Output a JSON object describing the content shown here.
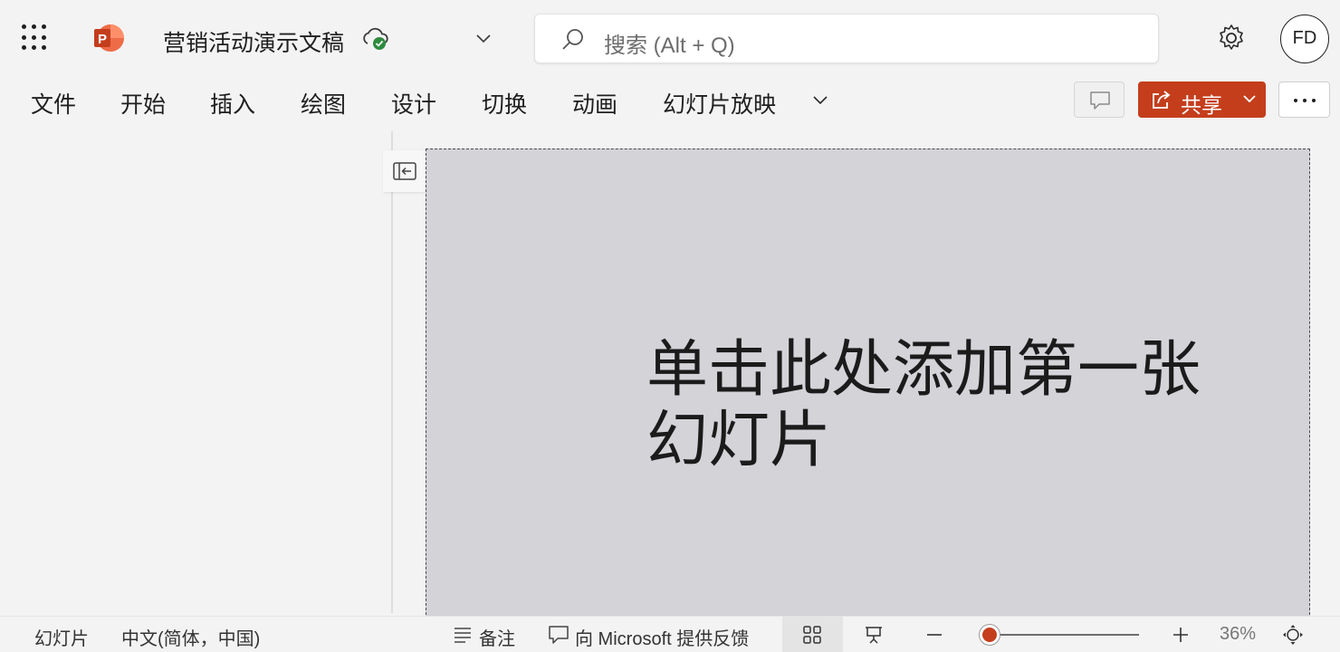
{
  "app": {
    "document_title": "营销活动演示文稿",
    "icons": {
      "app_launcher": "waffle-icon",
      "app_logo": "powerpoint-logo",
      "save_status": "cloud-saved-icon",
      "settings": "gear-icon"
    },
    "search": {
      "placeholder": "搜索 (Alt + Q)"
    },
    "user": {
      "initials": "FD"
    }
  },
  "ribbon": {
    "tabs": [
      {
        "label": "文件"
      },
      {
        "label": "开始"
      },
      {
        "label": "插入"
      },
      {
        "label": "绘图"
      },
      {
        "label": "设计"
      },
      {
        "label": "切换"
      },
      {
        "label": "动画"
      },
      {
        "label": "幻灯片放映"
      }
    ],
    "share_label": "共享"
  },
  "slide": {
    "title_placeholder": "单击此处添加第一张幻灯片",
    "background_color": "#d3d3d8"
  },
  "statusbar": {
    "slide_label": "幻灯片",
    "language": "中文(简体，中国)",
    "notes_label": "备注",
    "feedback_label": "向 Microsoft 提供反馈",
    "zoom_percent": "36%",
    "zoom_value": 36
  },
  "colors": {
    "accent": "#c43e1c",
    "background": "#f3f3f3",
    "saved_check": "#2e8b3f"
  }
}
